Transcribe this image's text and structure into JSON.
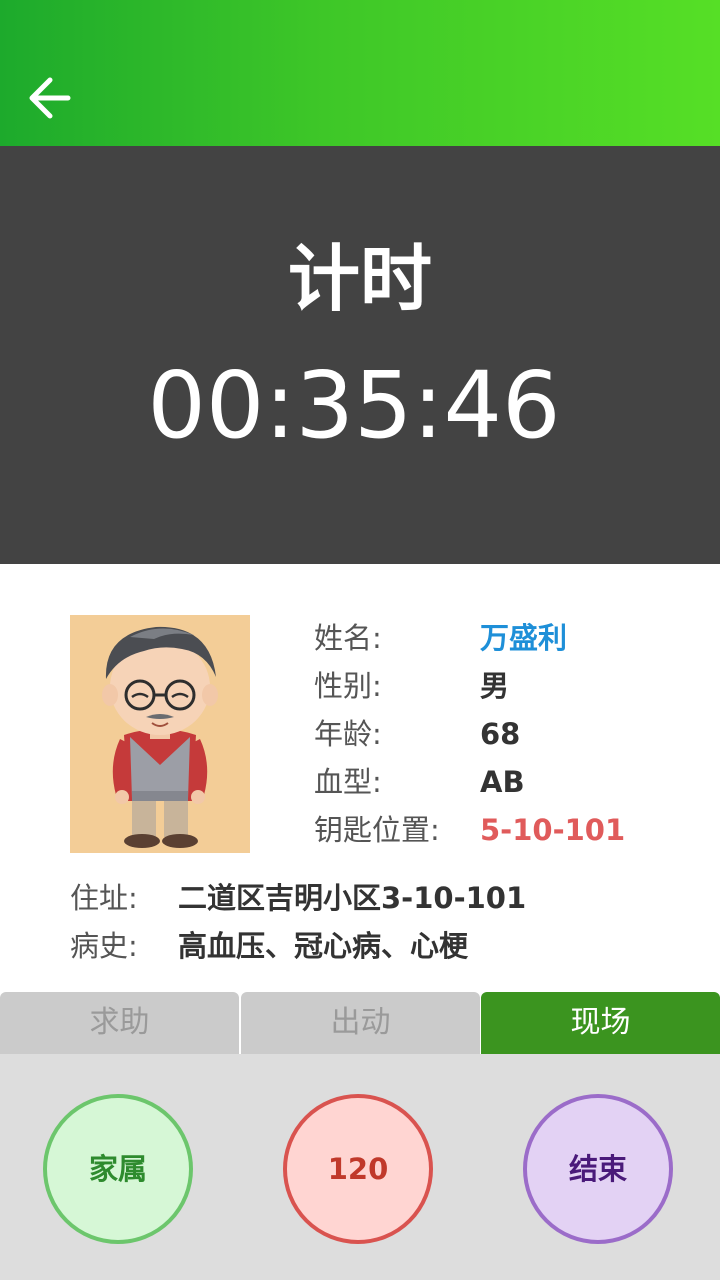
{
  "header": {
    "back_icon": "arrow-left-icon"
  },
  "timer": {
    "title": "计时",
    "value": "00:35:46"
  },
  "patient": {
    "avatar_icon": "elderly-man-cartoon",
    "fields": [
      {
        "label": "姓名:",
        "value": "万盛利",
        "color": "#1e8fd8"
      },
      {
        "label": "性别:",
        "value": "男"
      },
      {
        "label": "年龄:",
        "value": "68"
      },
      {
        "label": "血型:",
        "value": "AB"
      },
      {
        "label": "钥匙位置:",
        "value": "5-10-101",
        "color": "#e05b5b"
      }
    ],
    "address": {
      "label": "住址:",
      "value": "二道区吉明小区3-10-101"
    },
    "history": {
      "label": "病史:",
      "value": "高血压、冠心病、心梗"
    }
  },
  "tabs": [
    {
      "label": "求助",
      "active": false
    },
    {
      "label": "出动",
      "active": false
    },
    {
      "label": "现场",
      "active": true
    }
  ],
  "actions": [
    {
      "label": "家属",
      "border": "#6cc66c",
      "fill": "#d6f7d6",
      "text": "#2e8b2e"
    },
    {
      "label": "120",
      "border": "#d9534f",
      "fill": "#ffd5d2",
      "text": "#c0392b"
    },
    {
      "label": "结束",
      "border": "#9b6cc9",
      "fill": "#e3d2f4",
      "text": "#4a1a7a"
    }
  ],
  "colors": {
    "header_gradient_start": "#1daa2c",
    "header_gradient_end": "#56df26",
    "timer_bg": "#434343",
    "active_tab": "#3b941f"
  }
}
